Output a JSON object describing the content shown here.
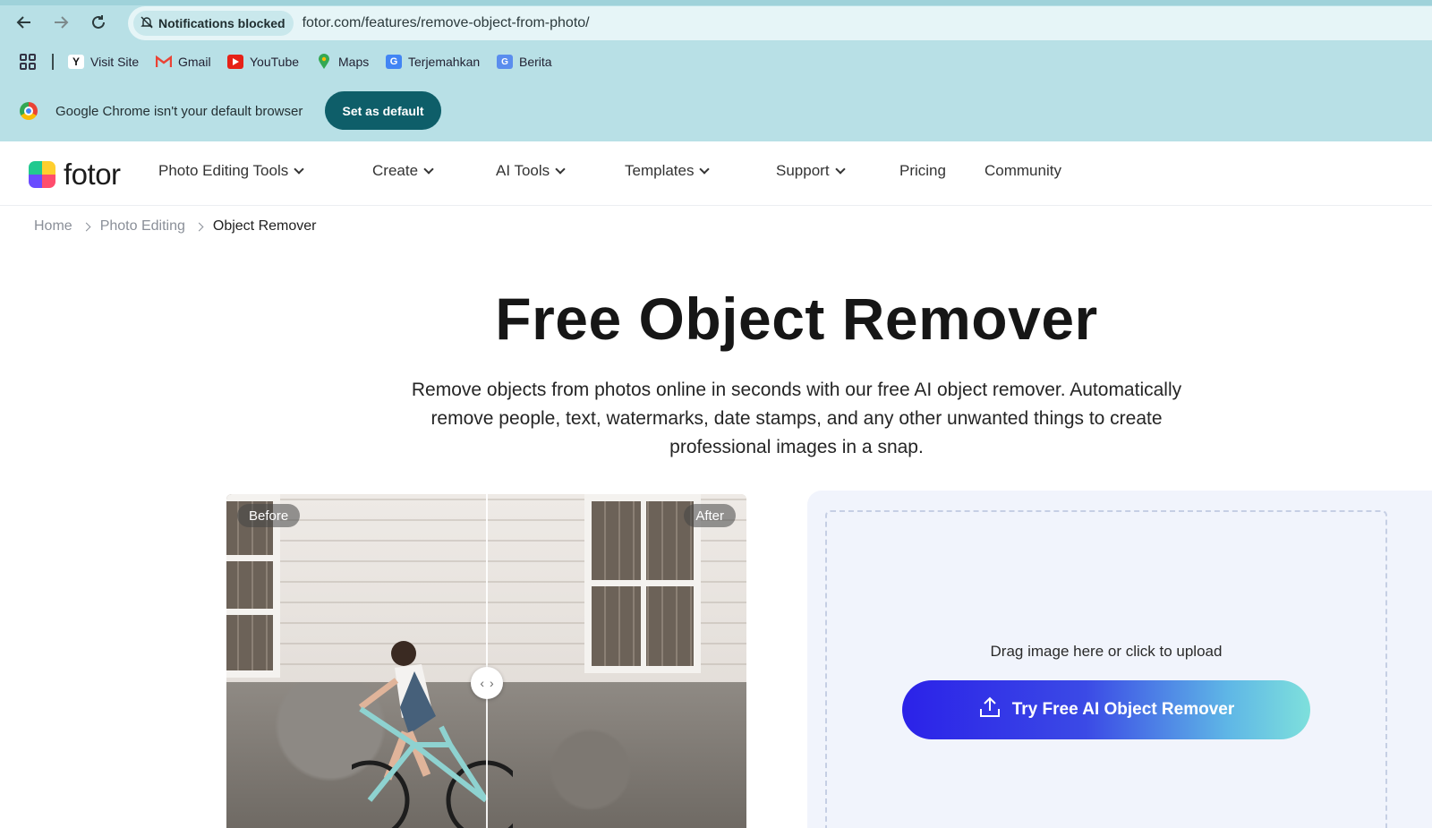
{
  "browser": {
    "notification_chip": "Notifications blocked",
    "url": "fotor.com/features/remove-object-from-photo/",
    "bookmarks": [
      {
        "label": "Visit Site",
        "icon": "yahoo-icon"
      },
      {
        "label": "Gmail",
        "icon": "gmail-icon"
      },
      {
        "label": "YouTube",
        "icon": "youtube-icon"
      },
      {
        "label": "Maps",
        "icon": "maps-icon"
      },
      {
        "label": "Terjemahkan",
        "icon": "translate-icon"
      },
      {
        "label": "Berita",
        "icon": "news-icon"
      }
    ],
    "infobar_text": "Google Chrome isn't your default browser",
    "set_default_label": "Set as default"
  },
  "site": {
    "logo_text": "fotor",
    "nav": [
      {
        "label": "Photo Editing Tools",
        "dropdown": true
      },
      {
        "label": "Create",
        "dropdown": true
      },
      {
        "label": "AI Tools",
        "dropdown": true
      },
      {
        "label": "Templates",
        "dropdown": true
      },
      {
        "label": "Support",
        "dropdown": true
      },
      {
        "label": "Pricing",
        "dropdown": false
      },
      {
        "label": "Community",
        "dropdown": false
      }
    ],
    "breadcrumb": [
      "Home",
      "Photo Editing",
      "Object Remover"
    ]
  },
  "hero": {
    "title": "Free Object Remover",
    "description_lines": [
      "Remove objects from photos online in seconds with our free AI object remover. Automatically",
      "remove people, text, watermarks, date stamps, and any other unwanted things to create",
      "professional images in a snap."
    ]
  },
  "comparison": {
    "before_label": "Before",
    "after_label": "After",
    "divider_position": 0.5
  },
  "upload": {
    "hint": "Drag image here or click to upload",
    "button_label": "Try Free AI Object Remover"
  },
  "colors": {
    "chrome_bg": "#b8e0e6",
    "set_default_bg": "#0e5e69",
    "cta_gradient_start": "#2b22e8",
    "cta_gradient_end": "#7ee0dc"
  }
}
